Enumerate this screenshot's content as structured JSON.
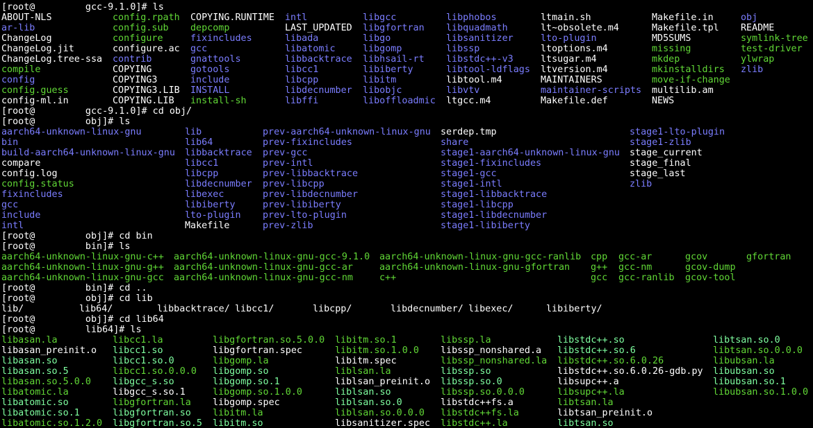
{
  "colors": {
    "background": "#000000",
    "text": "#ffffff",
    "executable": "#61d836",
    "directory": "#7b7dff",
    "symlink": "#7fffa0"
  },
  "lines": [
    [
      [
        "w",
        "[root@         gcc-9.1.0]# ls"
      ]
    ],
    [
      [
        "w",
        "ABOUT-NLS"
      ],
      [
        "g",
        "config.rpath"
      ],
      [
        "w",
        "COPYING.RUNTIME"
      ],
      [
        "b",
        "intl"
      ],
      [
        "b",
        "libgcc"
      ],
      [
        "b",
        "libphobos"
      ],
      [
        "w",
        "ltmain.sh"
      ],
      [
        "w",
        "Makefile.in"
      ],
      [
        "b",
        "obj"
      ]
    ],
    [
      [
        "b",
        "ar-lib"
      ],
      [
        "g",
        "config.sub"
      ],
      [
        "g",
        "depcomp"
      ],
      [
        "w",
        "LAST_UPDATED"
      ],
      [
        "b",
        "libgfortran"
      ],
      [
        "b",
        "libquadmath"
      ],
      [
        "w",
        "lt~obsolete.m4"
      ],
      [
        "w",
        "Makefile.tpl"
      ],
      [
        "w",
        "README"
      ]
    ],
    [
      [
        "w",
        "ChangeLog"
      ],
      [
        "g",
        "configure"
      ],
      [
        "b",
        "fixincludes"
      ],
      [
        "b",
        "libada"
      ],
      [
        "b",
        "libgo"
      ],
      [
        "b",
        "libsanitizer"
      ],
      [
        "b",
        "lto-plugin"
      ],
      [
        "w",
        "MD5SUMS"
      ],
      [
        "g",
        "symlink-tree"
      ]
    ],
    [
      [
        "w",
        "ChangeLog.jit"
      ],
      [
        "w",
        "configure.ac"
      ],
      [
        "b",
        "gcc"
      ],
      [
        "b",
        "libatomic"
      ],
      [
        "b",
        "libgomp"
      ],
      [
        "b",
        "libssp"
      ],
      [
        "w",
        "ltoptions.m4"
      ],
      [
        "g",
        "missing"
      ],
      [
        "g",
        "test-driver"
      ]
    ],
    [
      [
        "w",
        "ChangeLog.tree-ssa"
      ],
      [
        "b",
        "contrib"
      ],
      [
        "b",
        "gnattools"
      ],
      [
        "b",
        "libbacktrace"
      ],
      [
        "b",
        "libhsail-rt"
      ],
      [
        "b",
        "libstdc++-v3"
      ],
      [
        "w",
        "ltsugar.m4"
      ],
      [
        "g",
        "mkdep"
      ],
      [
        "g",
        "ylwrap"
      ]
    ],
    [
      [
        "g",
        "compile"
      ],
      [
        "w",
        "COPYING"
      ],
      [
        "b",
        "gotools"
      ],
      [
        "b",
        "libcc1"
      ],
      [
        "b",
        "libiberty"
      ],
      [
        "b",
        "libtool-ldflags"
      ],
      [
        "w",
        "ltversion.m4"
      ],
      [
        "g",
        "mkinstalldirs"
      ],
      [
        "b",
        "zlib"
      ]
    ],
    [
      [
        "b",
        "config"
      ],
      [
        "w",
        "COPYING3"
      ],
      [
        "b",
        "include"
      ],
      [
        "b",
        "libcpp"
      ],
      [
        "b",
        "libitm"
      ],
      [
        "w",
        "libtool.m4"
      ],
      [
        "w",
        "MAINTAINERS"
      ],
      [
        "g",
        "move-if-change"
      ]
    ],
    [
      [
        "g",
        "config.guess"
      ],
      [
        "w",
        "COPYING3.LIB"
      ],
      [
        "b",
        "INSTALL"
      ],
      [
        "b",
        "libdecnumber"
      ],
      [
        "b",
        "libobjc"
      ],
      [
        "b",
        "libvtv"
      ],
      [
        "b",
        "maintainer-scripts"
      ],
      [
        "w",
        "multilib.am"
      ]
    ],
    [
      [
        "w",
        "config-ml.in"
      ],
      [
        "w",
        "COPYING.LIB"
      ],
      [
        "g",
        "install-sh"
      ],
      [
        "b",
        "libffi"
      ],
      [
        "b",
        "liboffloadmic"
      ],
      [
        "w",
        "ltgcc.m4"
      ],
      [
        "w",
        "Makefile.def"
      ],
      [
        "w",
        "NEWS"
      ]
    ],
    [
      [
        "w",
        "[root@         gcc-9.1.0]# cd obj/"
      ]
    ],
    [
      [
        "w",
        "[root@         obj]# ls"
      ]
    ],
    [
      [
        "b",
        "aarch64-unknown-linux-gnu"
      ],
      [
        "b",
        "lib"
      ],
      [
        "b",
        "prev-aarch64-unknown-linux-gnu"
      ],
      [
        "w",
        "serdep.tmp"
      ],
      [
        "b",
        "stage1-lto-plugin"
      ]
    ],
    [
      [
        "b",
        "bin"
      ],
      [
        "b",
        "lib64"
      ],
      [
        "b",
        "prev-fixincludes"
      ],
      [
        "b",
        "share"
      ],
      [
        "b",
        "stage1-zlib"
      ]
    ],
    [
      [
        "b",
        "build-aarch64-unknown-linux-gnu"
      ],
      [
        "b",
        "libbacktrace"
      ],
      [
        "b",
        "prev-gcc"
      ],
      [
        "b",
        "stage1-aarch64-unknown-linux-gnu"
      ],
      [
        "w",
        "stage_current"
      ]
    ],
    [
      [
        "w",
        "compare"
      ],
      [
        "b",
        "libcc1"
      ],
      [
        "b",
        "prev-intl"
      ],
      [
        "b",
        "stage1-fixincludes"
      ],
      [
        "w",
        "stage_final"
      ]
    ],
    [
      [
        "w",
        "config.log"
      ],
      [
        "b",
        "libcpp"
      ],
      [
        "b",
        "prev-libbacktrace"
      ],
      [
        "b",
        "stage1-gcc"
      ],
      [
        "w",
        "stage_last"
      ]
    ],
    [
      [
        "g",
        "config.status"
      ],
      [
        "b",
        "libdecnumber"
      ],
      [
        "b",
        "prev-libcpp"
      ],
      [
        "b",
        "stage1-intl"
      ],
      [
        "b",
        "zlib"
      ]
    ],
    [
      [
        "b",
        "fixincludes"
      ],
      [
        "b",
        "libexec"
      ],
      [
        "b",
        "prev-libdecnumber"
      ],
      [
        "b",
        "stage1-libbacktrace"
      ]
    ],
    [
      [
        "b",
        "gcc"
      ],
      [
        "b",
        "libiberty"
      ],
      [
        "b",
        "prev-libiberty"
      ],
      [
        "b",
        "stage1-libcpp"
      ]
    ],
    [
      [
        "b",
        "include"
      ],
      [
        "b",
        "lto-plugin"
      ],
      [
        "b",
        "prev-lto-plugin"
      ],
      [
        "b",
        "stage1-libdecnumber"
      ]
    ],
    [
      [
        "b",
        "intl"
      ],
      [
        "w",
        "Makefile"
      ],
      [
        "b",
        "prev-zlib"
      ],
      [
        "b",
        "stage1-libiberty"
      ]
    ],
    [
      [
        "w",
        "[root@         obj]# cd bin"
      ]
    ],
    [
      [
        "w",
        "[root@         bin]# ls"
      ]
    ],
    [
      [
        "g",
        "aarch64-unknown-linux-gnu-c++"
      ],
      [
        "g",
        "aarch64-unknown-linux-gnu-gcc-9.1.0"
      ],
      [
        "g",
        "aarch64-unknown-linux-gnu-gcc-ranlib"
      ],
      [
        "g",
        "cpp"
      ],
      [
        "g",
        "gcc-ar"
      ],
      [
        "g",
        "gcov"
      ],
      [
        "g",
        "gfortran"
      ]
    ],
    [
      [
        "g",
        "aarch64-unknown-linux-gnu-g++"
      ],
      [
        "g",
        "aarch64-unknown-linux-gnu-gcc-ar"
      ],
      [
        "g",
        "aarch64-unknown-linux-gnu-gfortran"
      ],
      [
        "g",
        "g++"
      ],
      [
        "g",
        "gcc-nm"
      ],
      [
        "g",
        "gcov-dump"
      ]
    ],
    [
      [
        "g",
        "aarch64-unknown-linux-gnu-gcc"
      ],
      [
        "g",
        "aarch64-unknown-linux-gnu-gcc-nm"
      ],
      [
        "g",
        "c++"
      ],
      [
        "g",
        "gcc"
      ],
      [
        "g",
        "gcc-ranlib"
      ],
      [
        "g",
        "gcov-tool"
      ]
    ],
    [
      [
        "w",
        "[root@         bin]# cd .."
      ]
    ],
    [
      [
        "w",
        "[root@         obj]# cd lib"
      ]
    ],
    [
      [
        "w",
        "lib/"
      ],
      [
        "w",
        "lib64/"
      ],
      [
        "w",
        "libbacktrace/"
      ],
      [
        "w",
        "libcc1/"
      ],
      [
        "w",
        "libcpp/"
      ],
      [
        "w",
        "libdecnumber/"
      ],
      [
        "w",
        "libexec/"
      ],
      [
        "w",
        "libiberty/"
      ]
    ],
    [
      [
        "w",
        "[root@         obj]# cd lib64"
      ]
    ],
    [
      [
        "w",
        "[root@         lib64]# ls"
      ]
    ],
    [
      [
        "g",
        "libasan.la"
      ],
      [
        "g",
        "libcc1.la"
      ],
      [
        "g",
        "libgfortran.so.5.0.0"
      ],
      [
        "g",
        "libitm.so.1"
      ],
      [
        "g",
        "libssp.la"
      ],
      [
        "c",
        "libstdc++.so"
      ],
      [
        "c",
        "libtsan.so.0"
      ]
    ],
    [
      [
        "w",
        "libasan_preinit.o"
      ],
      [
        "c",
        "libcc1.so"
      ],
      [
        "w",
        "libgfortran.spec"
      ],
      [
        "g",
        "libitm.so.1.0.0"
      ],
      [
        "w",
        "libssp_nonshared.a"
      ],
      [
        "c",
        "libstdc++.so.6"
      ],
      [
        "g",
        "libtsan.so.0.0.0"
      ]
    ],
    [
      [
        "c",
        "libasan.so"
      ],
      [
        "c",
        "libcc1.so.0"
      ],
      [
        "g",
        "libgomp.la"
      ],
      [
        "w",
        "libitm.spec"
      ],
      [
        "g",
        "libssp_nonshared.la"
      ],
      [
        "g",
        "libstdc++.so.6.0.26"
      ],
      [
        "g",
        "libubsan.la"
      ]
    ],
    [
      [
        "c",
        "libasan.so.5"
      ],
      [
        "g",
        "libcc1.so.0.0.0"
      ],
      [
        "c",
        "libgomp.so"
      ],
      [
        "g",
        "liblsan.la"
      ],
      [
        "c",
        "libssp.so"
      ],
      [
        "w",
        "libstdc++.so.6.0.26-gdb.py"
      ],
      [
        "c",
        "libubsan.so"
      ]
    ],
    [
      [
        "g",
        "libasan.so.5.0.0"
      ],
      [
        "c",
        "libgcc_s.so"
      ],
      [
        "c",
        "libgomp.so.1"
      ],
      [
        "w",
        "liblsan_preinit.o"
      ],
      [
        "c",
        "libssp.so.0"
      ],
      [
        "w",
        "libsupc++.a"
      ],
      [
        "c",
        "libubsan.so.1"
      ]
    ],
    [
      [
        "g",
        "libatomic.la"
      ],
      [
        "w",
        "libgcc_s.so.1"
      ],
      [
        "g",
        "libgomp.so.1.0.0"
      ],
      [
        "c",
        "liblsan.so"
      ],
      [
        "g",
        "libssp.so.0.0.0"
      ],
      [
        "g",
        "libsupc++.la"
      ],
      [
        "g",
        "libubsan.so.1.0.0"
      ]
    ],
    [
      [
        "c",
        "libatomic.so"
      ],
      [
        "g",
        "libgfortran.la"
      ],
      [
        "w",
        "libgomp.spec"
      ],
      [
        "c",
        "liblsan.so.0"
      ],
      [
        "w",
        "libstdc++fs.a"
      ],
      [
        "g",
        "libtsan.la"
      ]
    ],
    [
      [
        "c",
        "libatomic.so.1"
      ],
      [
        "c",
        "libgfortran.so"
      ],
      [
        "g",
        "libitm.la"
      ],
      [
        "g",
        "liblsan.so.0.0.0"
      ],
      [
        "g",
        "libstdc++fs.la"
      ],
      [
        "w",
        "libtsan_preinit.o"
      ]
    ],
    [
      [
        "g",
        "libatomic.so.1.2.0"
      ],
      [
        "c",
        "libgfortran.so.5"
      ],
      [
        "c",
        "libitm.so"
      ],
      [
        "w",
        "libsanitizer.spec"
      ],
      [
        "g",
        "libstdc++.la"
      ],
      [
        "c",
        "libtsan.so"
      ]
    ]
  ]
}
